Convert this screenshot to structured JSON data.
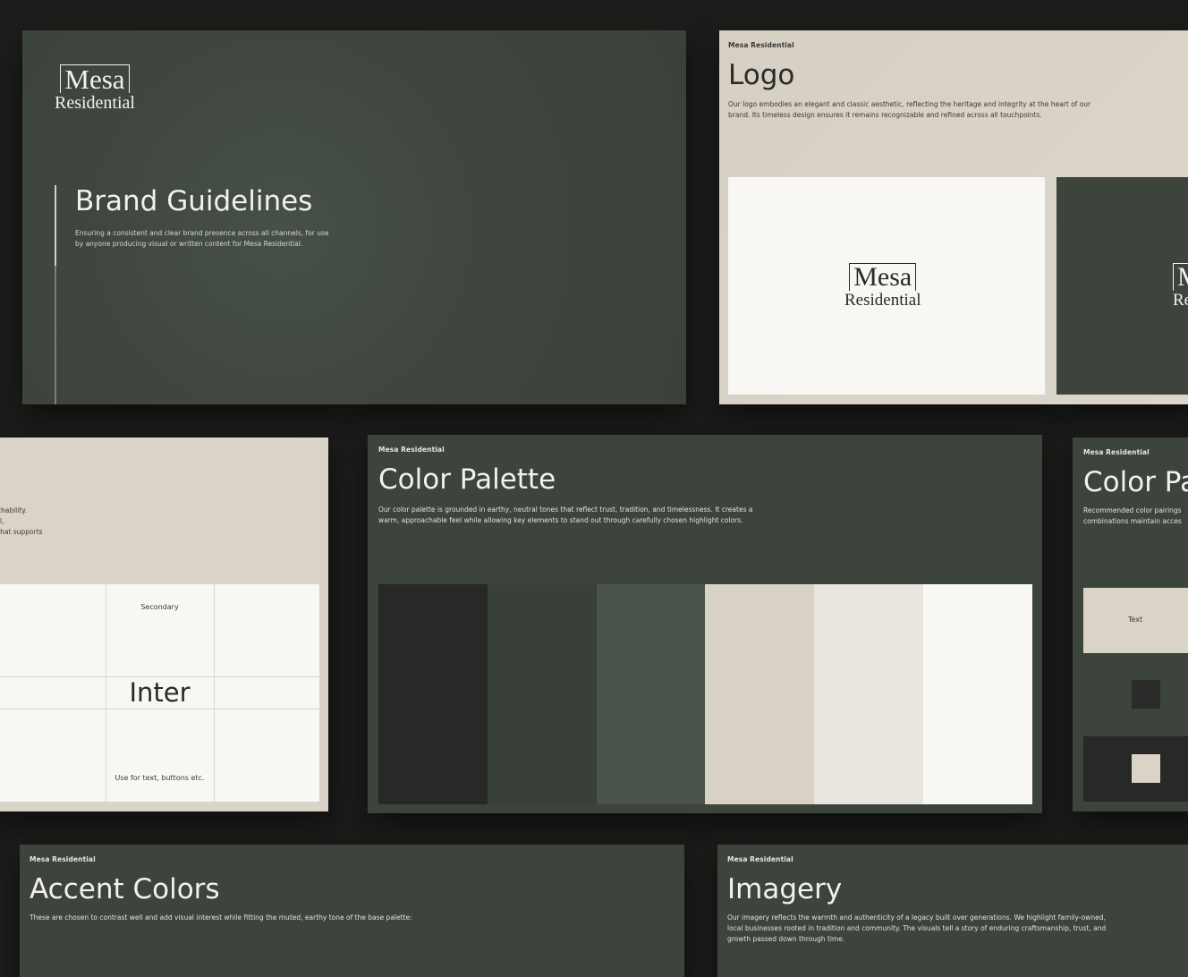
{
  "brand": {
    "name": "Mesa Residential",
    "logo_top": "Mesa",
    "logo_bottom": "Residential"
  },
  "cover": {
    "title": "Brand Guidelines",
    "subtitle_line1": "Ensuring a consistent and clear brand presence across all channels, for use",
    "subtitle_line2": "by anyone producing visual or written content for Mesa Residential."
  },
  "logo_slide": {
    "eyebrow": "Mesa Residential",
    "title": "Logo",
    "body_line1": "Our logo embodies an elegant and classic aesthetic, reflecting the heritage and integrity at the heart of our",
    "body_line2": "brand. Its timeless design ensures it remains recognizable and refined across all touchpoints.",
    "dark_logo_top": "M",
    "dark_logo_bottom": "Re"
  },
  "type_slide": {
    "body_line1": "proachability.",
    "body_line2": "eutral,",
    "body_line3": "tem that supports",
    "label": "Secondary",
    "font_name": "Inter",
    "usage": "Use for text, buttons etc."
  },
  "palette_slide": {
    "eyebrow": "Mesa Residential",
    "title": "Color Palette",
    "body_line1": "Our color palette is grounded in earthy, neutral tones that reflect trust, tradition, and timelessness. It creates a",
    "body_line2": "warm, approachable feel while allowing key elements to stand out through carefully chosen highlight colors.",
    "swatches": [
      "#282826",
      "#394038",
      "#4b544a",
      "#d7d1c7",
      "#e8e4de",
      "#f8f7f3"
    ]
  },
  "pairs_slide": {
    "eyebrow": "Mesa Residential",
    "title": "Color Pa",
    "body_line1": "Recommended color pairings",
    "body_line2": "combinations maintain acces",
    "text_label": "Text"
  },
  "accent_slide": {
    "eyebrow": "Mesa Residential",
    "title": "Accent Colors",
    "body_line1": "These are chosen to contrast well and add visual interest while fitting the muted, earthy tone of the base palette:"
  },
  "imagery_slide": {
    "eyebrow": "Mesa Residential",
    "title": "Imagery",
    "body_line1": "Our imagery reflects the warmth and authenticity of a legacy built over generations. We highlight family-owned,",
    "body_line2": "local businesses rooted in tradition and community. The visuals tell a story of enduring craftsmanship, trust, and",
    "body_line3": "growth passed down through time."
  },
  "colors": {
    "background": "#1d1e1c",
    "forest": "#3d443c",
    "sand": "#d9d3c8",
    "ivory": "#f8f7f3"
  }
}
